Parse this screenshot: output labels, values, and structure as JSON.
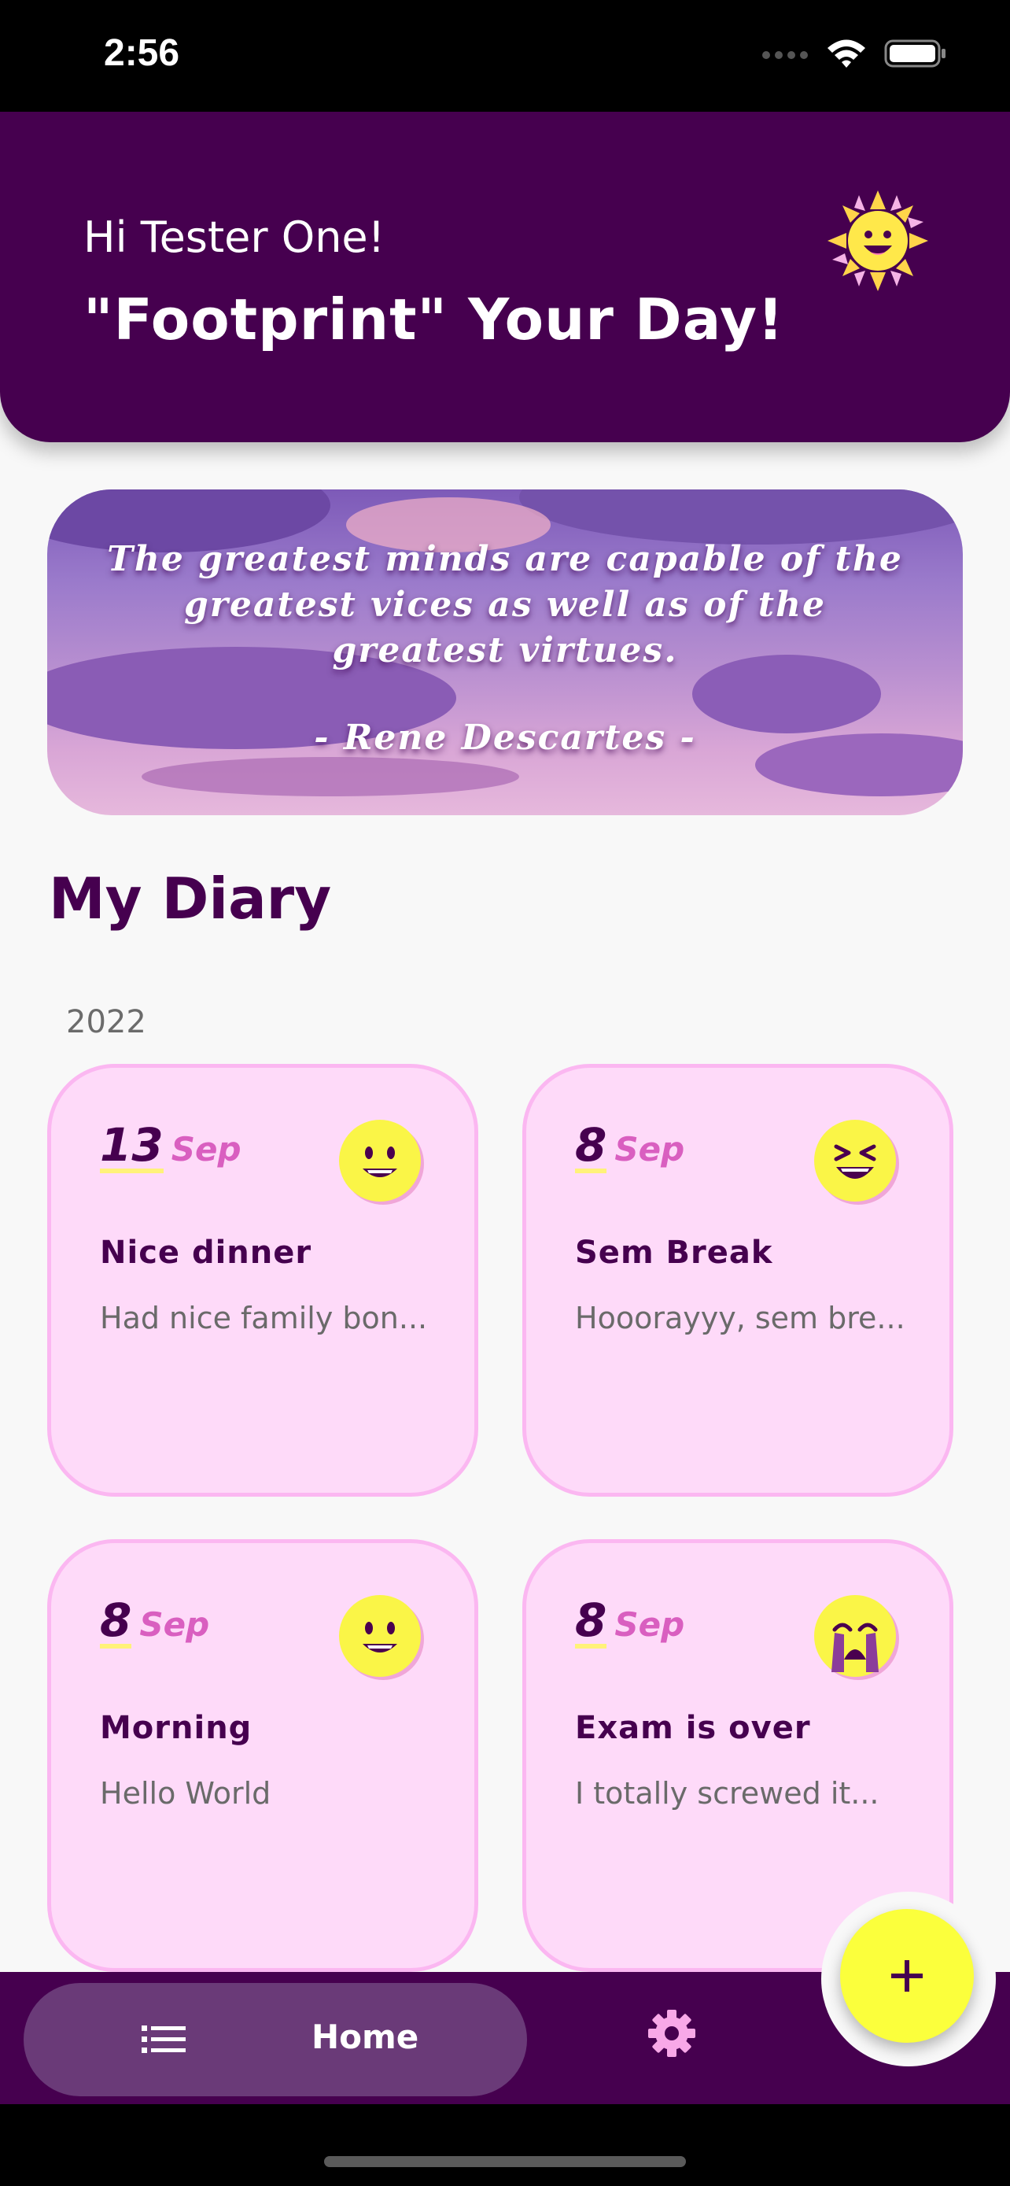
{
  "status_bar": {
    "time": "2:56"
  },
  "header": {
    "greeting": "Hi Tester One!",
    "headline": "\"Footprint\" Your Day!"
  },
  "quote": {
    "text": "The greatest minds are capable of the greatest vices as well as of the greatest virtues.",
    "author": "- Rene Descartes -"
  },
  "diary": {
    "title": "My Diary",
    "year": "2022",
    "entries": [
      {
        "day": "13",
        "month": "Sep",
        "title": "Nice dinner",
        "preview": "Had nice family bon...",
        "mood": "smile"
      },
      {
        "day": "8",
        "month": "Sep",
        "title": "Sem Break",
        "preview": "Hooorayyy, sem bre...",
        "mood": "laughing"
      },
      {
        "day": "8",
        "month": "Sep",
        "title": "Morning",
        "preview": "Hello World",
        "mood": "smile"
      },
      {
        "day": "8",
        "month": "Sep",
        "title": "Exam is over",
        "preview": "I totally screwed it...",
        "mood": "crying"
      }
    ]
  },
  "bottom_nav": {
    "home_label": "Home",
    "home_icon": "list-icon",
    "settings_icon": "gear-icon"
  },
  "fab": {
    "icon": "plus-icon"
  },
  "colors": {
    "primary": "#46004f",
    "card_bg": "#fedaf9",
    "card_border": "#fbb7f1",
    "accent_yellow": "#fbff3c",
    "month_pink": "#d95fc0"
  }
}
